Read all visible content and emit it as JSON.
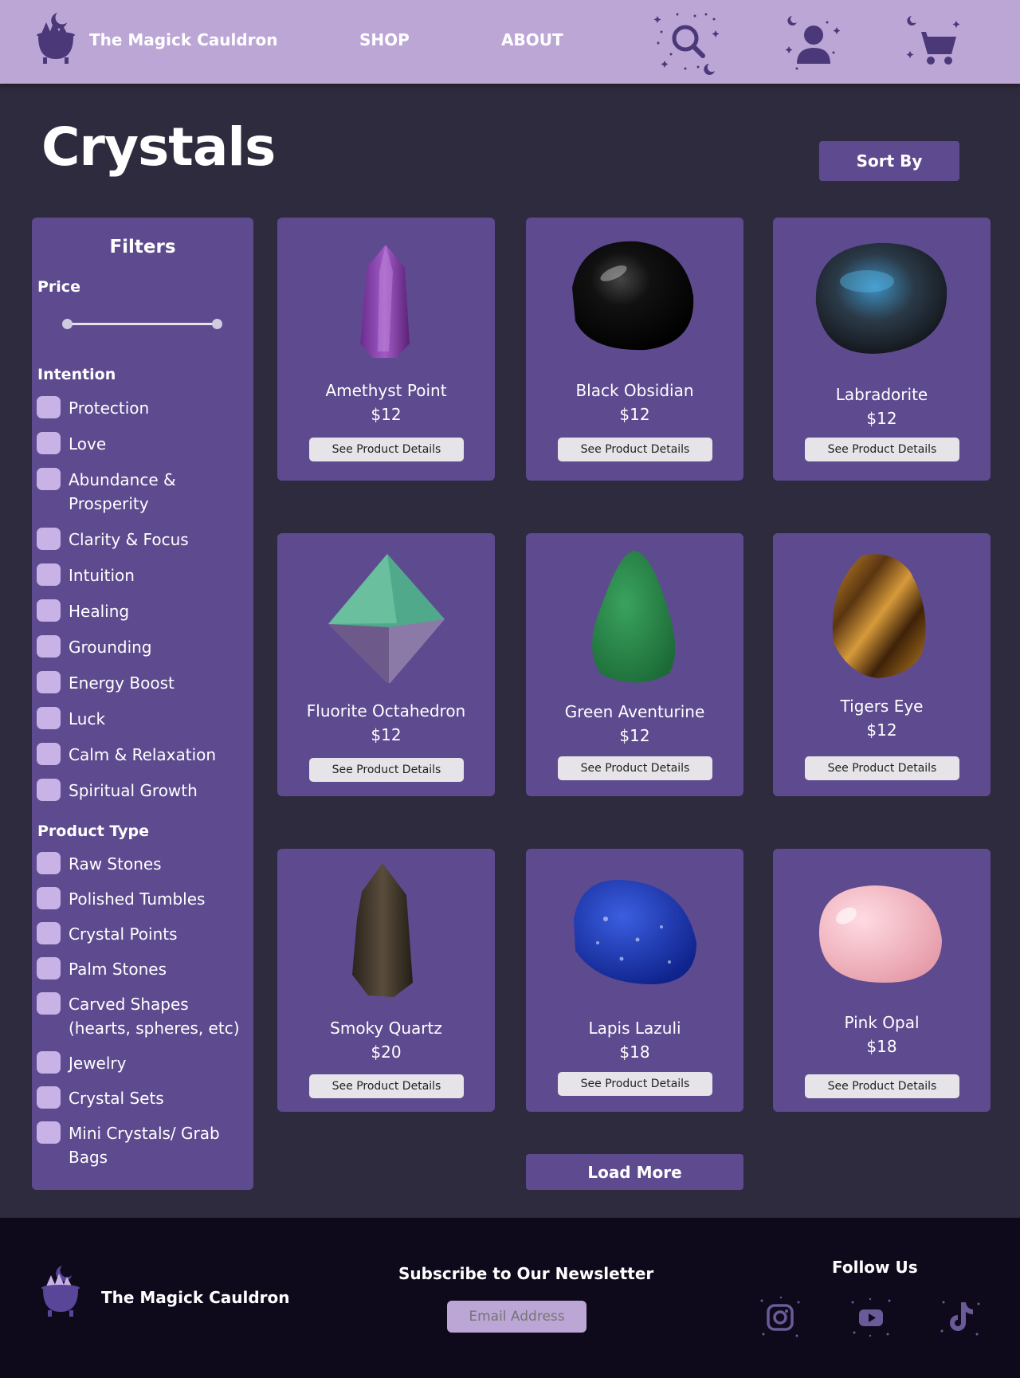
{
  "header": {
    "brand": "The Magick Cauldron",
    "nav": {
      "shop": "SHOP",
      "about": "ABOUT"
    },
    "icons": [
      "cauldron-logo-icon",
      "search-icon",
      "user-icon",
      "cart-icon"
    ]
  },
  "page": {
    "title": "Crystals",
    "sort_label": "Sort By"
  },
  "filters": {
    "title": "Filters",
    "price_label": "Price",
    "price_range": [
      0,
      1
    ],
    "intention_label": "Intention",
    "intentions": [
      "Protection",
      "Love",
      "Abundance &\nProsperity",
      "Clarity & Focus",
      "Intuition",
      "Healing",
      "Grounding",
      "Energy Boost",
      "Luck",
      "Calm & Relaxation",
      "Spiritual Growth"
    ],
    "type_label": "Product Type",
    "types": [
      "Raw Stones",
      "Polished Tumbles",
      "Crystal Points",
      "Palm Stones",
      "Carved Shapes\n(hearts, spheres, etc)",
      "Jewelry",
      "Crystal Sets",
      "Mini Crystals/ Grab\nBags"
    ]
  },
  "products": [
    {
      "name": "Amethyst Point",
      "price": "$12",
      "button": "See Product Details"
    },
    {
      "name": "Black Obsidian",
      "price": "$12",
      "button": "See Product Details"
    },
    {
      "name": "Labradorite",
      "price": "$12",
      "button": "See Product Details"
    },
    {
      "name": "Fluorite Octahedron",
      "price": "$12",
      "button": "See Product Details"
    },
    {
      "name": "Green Aventurine",
      "price": "$12",
      "button": "See Product Details"
    },
    {
      "name": "Tigers Eye",
      "price": "$12",
      "button": "See Product Details"
    },
    {
      "name": "Smoky Quartz",
      "price": "$20",
      "button": "See Product Details"
    },
    {
      "name": "Lapis Lazuli",
      "price": "$18",
      "button": "See Product Details"
    },
    {
      "name": "Pink Opal",
      "price": "$18",
      "button": "See Product Details"
    }
  ],
  "load_more": "Load More",
  "footer": {
    "brand": "The Magick Cauldron",
    "newsletter_title": "Subscribe to Our Newsletter",
    "email_placeholder": "Email Address",
    "follow_title": "Follow Us",
    "social_icons": [
      "instagram-icon",
      "youtube-icon",
      "tiktok-icon"
    ]
  },
  "colors": {
    "header_bg": "#bca6d6",
    "page_bg": "#2f2b3e",
    "panel": "#5e4a8f",
    "checkbox": "#c9b3e6",
    "footer_bg": "#0e0a1c"
  }
}
